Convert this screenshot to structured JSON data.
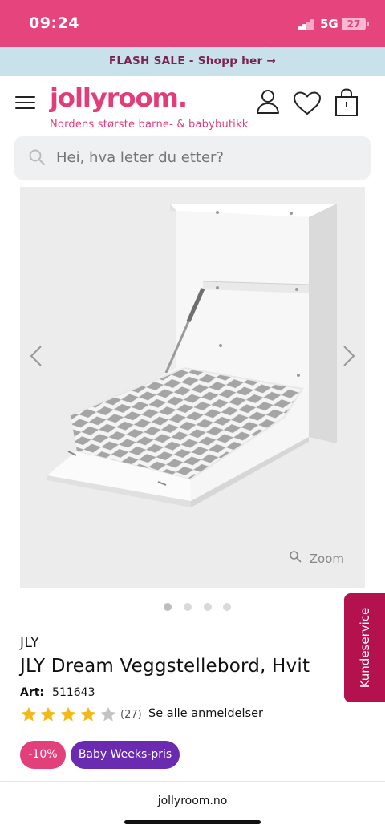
{
  "status_bar": {
    "time": "09:24",
    "network": "5G",
    "battery": "27"
  },
  "promo": {
    "text": "FLASH SALE - Shopp her →"
  },
  "header": {
    "logo": "jollyroom.",
    "tagline": "Nordens største barne- & babybutikk",
    "icons": [
      "menu-icon",
      "account-icon",
      "wishlist-heart-icon",
      "shopping-bag-icon"
    ]
  },
  "search": {
    "placeholder": "Hei, hva leter du etter?"
  },
  "gallery": {
    "zoom_label": "Zoom",
    "image_count": 4,
    "active_index": 0
  },
  "product": {
    "brand": "JLY",
    "title": "JLY Dream Veggstellebord, Hvit",
    "art_label": "Art:",
    "art_number": "511643",
    "rating": 4,
    "rating_max": 5,
    "review_count": "(27)",
    "reviews_link": "Se alle anmeldelser",
    "badges": {
      "discount": "-10%",
      "campaign": "Baby Weeks-pris"
    }
  },
  "service_tab": {
    "label": "Kundeservice"
  },
  "browser": {
    "url": "jollyroom.no"
  },
  "colors": {
    "brand_pink": "#e23d7a",
    "status_pink": "#e5447c",
    "promo_bg": "#c8e1ea",
    "campaign_purple": "#6b2bb0",
    "service_red": "#b3124e",
    "star_yellow": "#f5b915"
  }
}
